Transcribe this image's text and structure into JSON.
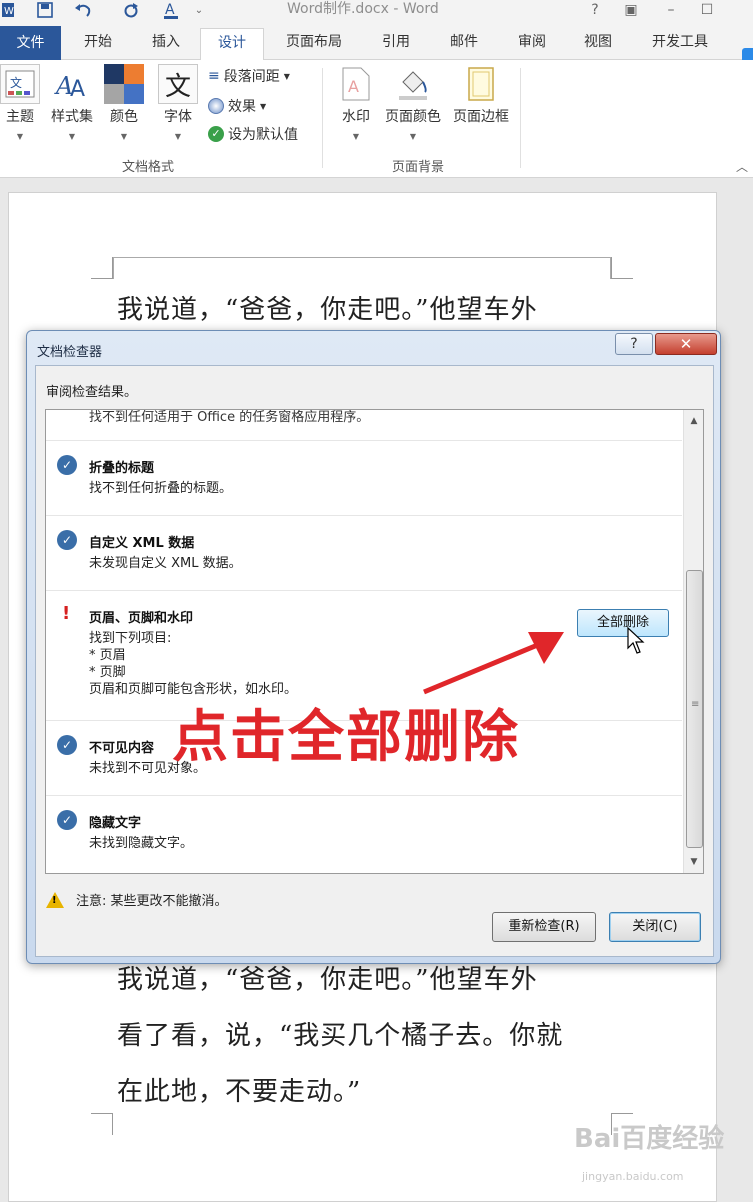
{
  "window": {
    "title": "Word制作.docx - Word",
    "app_icon": "word-app-icon",
    "quick_access": [
      "save-icon",
      "undo-icon",
      "redo-icon",
      "font-color-icon",
      "qat-customize-icon"
    ],
    "controls": [
      "?",
      "restore-ribbon-icon",
      "minimize-icon",
      "maximize-icon"
    ]
  },
  "tabs": [
    "文件",
    "开始",
    "插入",
    "设计",
    "页面布局",
    "引用",
    "邮件",
    "审阅",
    "视图",
    "开发工具"
  ],
  "active_tab": "设计",
  "ribbon": {
    "doc_format": {
      "buttons": [
        "主题",
        "样式集",
        "颜色",
        "字体"
      ],
      "small": [
        "段落间距",
        "效果",
        "设为默认值"
      ],
      "label": "文档格式"
    },
    "page_background": {
      "buttons": [
        "水印",
        "页面颜色",
        "页面边框"
      ],
      "label": "页面背景"
    }
  },
  "document": {
    "top_line": "我说道，“爸爸，你走吧。”他望车外",
    "lines": [
      "我说道，“爸爸，你走吧。”他望车外",
      "看了看，说，“我买几个橘子去。你就",
      "在此地，不要走动。”"
    ]
  },
  "dialog": {
    "title": "文档检查器",
    "help": "?",
    "close": "✕",
    "subtitle": "审阅检查结果。",
    "truncated_text": "找不到任何适用于 Office 的任务窗格应用程序。",
    "items": [
      {
        "status": "ok",
        "name": "折叠的标题",
        "desc": [
          "找不到任何折叠的标题。"
        ]
      },
      {
        "status": "ok",
        "name": "自定义 XML 数据",
        "desc": [
          "未发现自定义 XML 数据。"
        ]
      },
      {
        "status": "warn",
        "name": "页眉、页脚和水印",
        "desc": [
          "找到下列项目:",
          "* 页眉",
          "* 页脚",
          "页眉和页脚可能包含形状，如水印。"
        ],
        "action": "全部删除"
      },
      {
        "status": "ok",
        "name": "不可见内容",
        "desc": [
          "未找到不可见对象。"
        ]
      },
      {
        "status": "ok",
        "name": "隐藏文字",
        "desc": [
          "未找到隐藏文字。"
        ]
      }
    ],
    "note": "注意: 某些更改不能撤消。",
    "recheck": "重新检查(R)",
    "close_button": "关闭(C)"
  },
  "annotation": "点击全部删除",
  "watermark": {
    "logo": "Bai百度经验",
    "url": "jingyan.baidu.com"
  },
  "colors": {
    "word_blue": "#2b579a",
    "annotation_red": "#e0262a",
    "dialog_frame": "#c9d9ee"
  }
}
